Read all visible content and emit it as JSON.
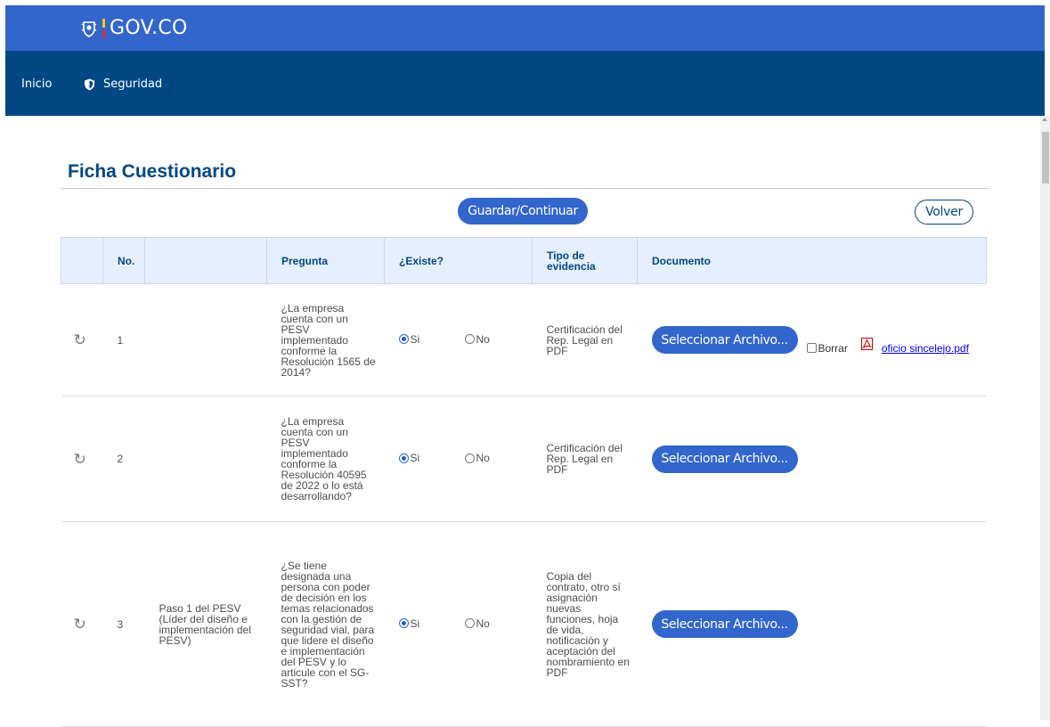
{
  "header": {
    "logo_text": "GOV.CO"
  },
  "nav": {
    "items": [
      {
        "label": "Inicio"
      },
      {
        "label": "Seguridad"
      }
    ]
  },
  "page": {
    "title": "Ficha Cuestionario",
    "save_button": "Guardar/Continuar",
    "back_button": "Volver"
  },
  "table": {
    "columns": [
      "",
      "No.",
      "",
      "Pregunta",
      "¿Existe?",
      "Tipo de evidencia",
      "Documento"
    ],
    "rows": [
      {
        "no": "1",
        "paso": "",
        "pregunta": "¿La empresa cuenta con un PESV implementado conforme la Resolución 1565 de 2014?",
        "existe": {
          "si_label": "Si",
          "no_label": "No",
          "selected": "Si"
        },
        "evidencia": "Certificación del Rep. Legal en PDF",
        "doc_button": "Seleccionar Archivo...",
        "borrar_label": "Borrar",
        "file_link": "oficio sincelejo.pdf"
      },
      {
        "no": "2",
        "paso": "",
        "pregunta": "¿La empresa cuenta con un PESV implementado conforme la Resolución 40595 de 2022 o lo está desarrollando?",
        "existe": {
          "si_label": "Si",
          "no_label": "No",
          "selected": "Si"
        },
        "evidencia": "Certificación del Rep. Legal en PDF",
        "doc_button": "Seleccionar Archivo..."
      },
      {
        "no": "3",
        "paso": "Paso 1 del PESV (Líder del diseño e implementación del PESV)",
        "pregunta": "¿Se tiene designada una persona con poder de decisión en los temas relacionados con la gestión de seguridad vial, para que lidere el diseño e implementación del PESV y lo articule con el SG-SST?",
        "existe": {
          "si_label": "Si",
          "no_label": "No",
          "selected": "Si"
        },
        "evidencia": "Copia del contrato, otro sí asignación nuevas funciones, hoja de vida, notificación y aceptación del nombramiento en PDF",
        "doc_button": "Seleccionar Archivo..."
      }
    ]
  },
  "colors": {
    "brand_blue": "#3366cc",
    "nav_dark": "#004884",
    "header_bg": "#e6effd"
  },
  "icons": [
    "colombia-shield-icon",
    "shield-icon",
    "refresh-icon",
    "pdf-icon"
  ]
}
